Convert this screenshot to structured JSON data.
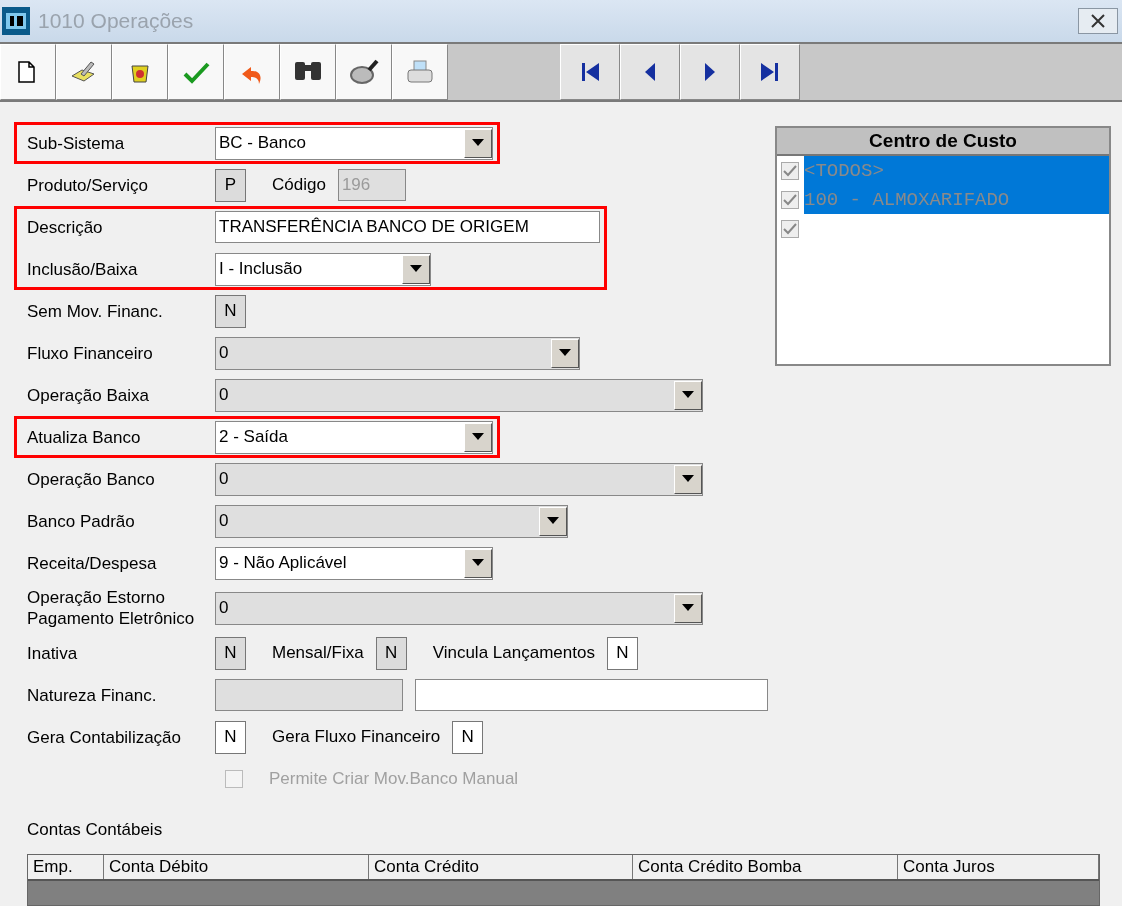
{
  "window": {
    "title": "1010 Operações"
  },
  "form": {
    "groups": [
      {
        "highlighted": true,
        "rows": [
          {
            "label": "Sub-Sistema",
            "controls": [
              {
                "kind": "combo",
                "value": "BC - Banco",
                "disabled": false
              }
            ]
          }
        ]
      },
      {
        "highlighted": false,
        "rows": [
          {
            "label": "Produto/Serviço",
            "controls": [
              {
                "kind": "flag",
                "value": "P",
                "disabled": true
              },
              {
                "kind": "text",
                "caption": "Código",
                "value": "196",
                "disabled": true
              }
            ]
          }
        ]
      },
      {
        "highlighted": true,
        "rows": [
          {
            "label": "Descrição",
            "controls": [
              {
                "kind": "text",
                "value": "TRANSFERÊNCIA BANCO DE ORIGEM",
                "disabled": false
              }
            ]
          },
          {
            "label": "Inclusão/Baixa",
            "controls": [
              {
                "kind": "combo",
                "value": "I - Inclusão",
                "disabled": false
              }
            ]
          }
        ]
      },
      {
        "highlighted": false,
        "rows": [
          {
            "label": "Sem Mov. Financ.",
            "controls": [
              {
                "kind": "flag",
                "value": "N",
                "disabled": true
              }
            ]
          },
          {
            "label": "Fluxo Financeiro",
            "controls": [
              {
                "kind": "combo",
                "value": "0",
                "disabled": true
              }
            ]
          },
          {
            "label": "Operação Baixa",
            "controls": [
              {
                "kind": "combo",
                "value": "0",
                "disabled": true
              }
            ]
          }
        ]
      },
      {
        "highlighted": true,
        "rows": [
          {
            "label": "Atualiza Banco",
            "controls": [
              {
                "kind": "combo",
                "value": "2 - Saída",
                "disabled": false
              }
            ]
          }
        ]
      },
      {
        "highlighted": false,
        "rows": [
          {
            "label": "Operação Banco",
            "controls": [
              {
                "kind": "combo",
                "value": "0",
                "disabled": true
              }
            ]
          },
          {
            "label": "Banco Padrão",
            "controls": [
              {
                "kind": "combo",
                "value": "0",
                "disabled": true
              }
            ]
          },
          {
            "label": "Receita/Despesa",
            "controls": [
              {
                "kind": "combo",
                "value": "9 - Não Aplicável",
                "disabled": false
              }
            ]
          },
          {
            "label": "Operação Estorno Pagamento Eletrônico",
            "controls": [
              {
                "kind": "combo",
                "value": "0",
                "disabled": true
              }
            ]
          },
          {
            "label": "Inativa",
            "controls": [
              {
                "kind": "flag",
                "value": "N",
                "disabled": true
              },
              {
                "kind": "flag",
                "caption": "Mensal/Fixa",
                "value": "N",
                "disabled": true
              },
              {
                "kind": "flag",
                "caption": "Vincula Lançamentos",
                "value": "N",
                "disabled": false
              }
            ]
          },
          {
            "label": "Natureza Financ.",
            "controls": [
              {
                "kind": "text",
                "disabled": true
              },
              {
                "kind": "text",
                "disabled": false
              }
            ]
          },
          {
            "label": "Gera Contabilização",
            "controls": [
              {
                "kind": "flag",
                "value": "N",
                "disabled": false
              },
              {
                "kind": "flag",
                "caption": "Gera Fluxo Financeiro",
                "value": "N",
                "disabled": false
              }
            ]
          },
          {
            "controls": [
              {
                "kind": "checkbox",
                "caption": "Permite Criar Mov.Banco Manual",
                "checked": false,
                "disabled": true
              }
            ]
          }
        ]
      }
    ]
  },
  "cost_centers": {
    "title": "Centro de Custo",
    "items": [
      {
        "label": "<TODOS>",
        "checked": true,
        "selected": true
      },
      {
        "label": "100 - ALMOXARIFADO",
        "checked": true,
        "selected": true
      },
      {
        "checked": true,
        "selected": false
      }
    ]
  },
  "accounts": {
    "title": "Contas Contábeis",
    "columns": [
      "Emp.",
      "Conta Débito",
      "Conta Crédito",
      "Conta Crédito Bomba",
      "Conta Juros"
    ]
  }
}
